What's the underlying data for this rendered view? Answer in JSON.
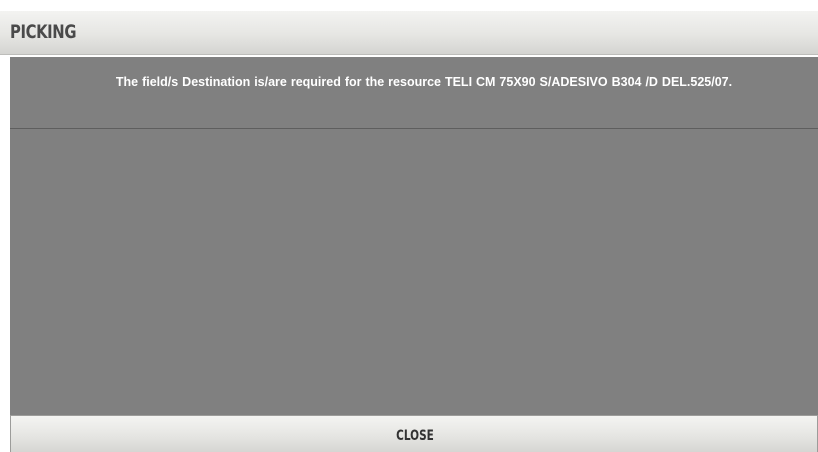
{
  "dialog": {
    "title": "PICKING",
    "message": "The field/s Destination is/are required for the resource TELI CM 75X90 S/ADESIVO  B304   /D DEL.525/07.",
    "close_label": "CLOSE"
  },
  "colors": {
    "panel_background": "#808080",
    "message_text": "#ffffff",
    "title_text": "#4a4a4a"
  }
}
